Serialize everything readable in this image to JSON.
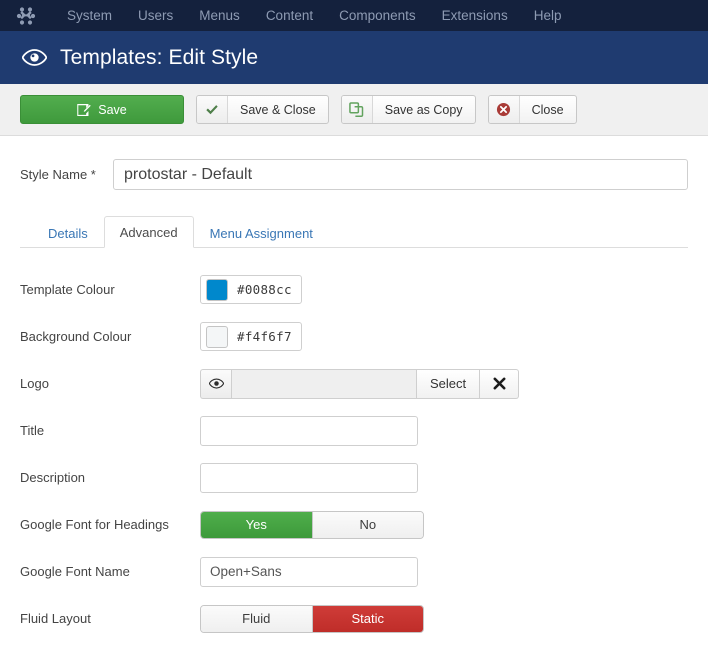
{
  "topnav": {
    "logo_icon": "joomla-logo-icon",
    "items": [
      {
        "label": "System"
      },
      {
        "label": "Users"
      },
      {
        "label": "Menus"
      },
      {
        "label": "Content"
      },
      {
        "label": "Components"
      },
      {
        "label": "Extensions"
      },
      {
        "label": "Help"
      }
    ]
  },
  "header": {
    "icon": "eye-icon",
    "title": "Templates: Edit Style"
  },
  "toolbar": {
    "save": {
      "label": "Save",
      "icon": "edit-square-icon"
    },
    "save_close": {
      "label": "Save & Close",
      "icon": "check-icon"
    },
    "save_copy": {
      "label": "Save as Copy",
      "icon": "copy-icon"
    },
    "close": {
      "label": "Close",
      "icon": "circle-x-icon"
    }
  },
  "form": {
    "style_name": {
      "label": "Style Name *",
      "value": "protostar - Default"
    },
    "tabs": [
      {
        "label": "Details",
        "active": false
      },
      {
        "label": "Advanced",
        "active": true
      },
      {
        "label": "Menu Assignment",
        "active": false
      }
    ],
    "fields": {
      "template_colour": {
        "label": "Template Colour",
        "value": "#0088cc",
        "swatch": "#0088cc"
      },
      "background_colour": {
        "label": "Background Colour",
        "value": "#f4f6f7",
        "swatch": "#f4f6f7"
      },
      "logo": {
        "label": "Logo",
        "value": "",
        "placeholder": "",
        "preview_icon": "eye-icon",
        "select_label": "Select",
        "clear_icon": "x-icon"
      },
      "title": {
        "label": "Title",
        "value": "",
        "placeholder": ""
      },
      "description": {
        "label": "Description",
        "value": "",
        "placeholder": ""
      },
      "google_font_headings": {
        "label": "Google Font for Headings",
        "options": [
          {
            "label": "Yes",
            "state": "on-green"
          },
          {
            "label": "No",
            "state": "off"
          }
        ]
      },
      "google_font_name": {
        "label": "Google Font Name",
        "value": "Open+Sans",
        "placeholder": "Open+Sans"
      },
      "fluid_layout": {
        "label": "Fluid Layout",
        "options": [
          {
            "label": "Fluid",
            "state": "off"
          },
          {
            "label": "Static",
            "state": "on-red"
          }
        ]
      }
    }
  },
  "colors": {
    "topnav_bg": "#14213d",
    "header_bg": "#1f3b70",
    "toolbar_bg": "#f0f0f0",
    "save_green": "#3f9a3c",
    "toggle_green": "#41a540",
    "toggle_red": "#c9302c",
    "link_blue": "#3a77b5"
  }
}
